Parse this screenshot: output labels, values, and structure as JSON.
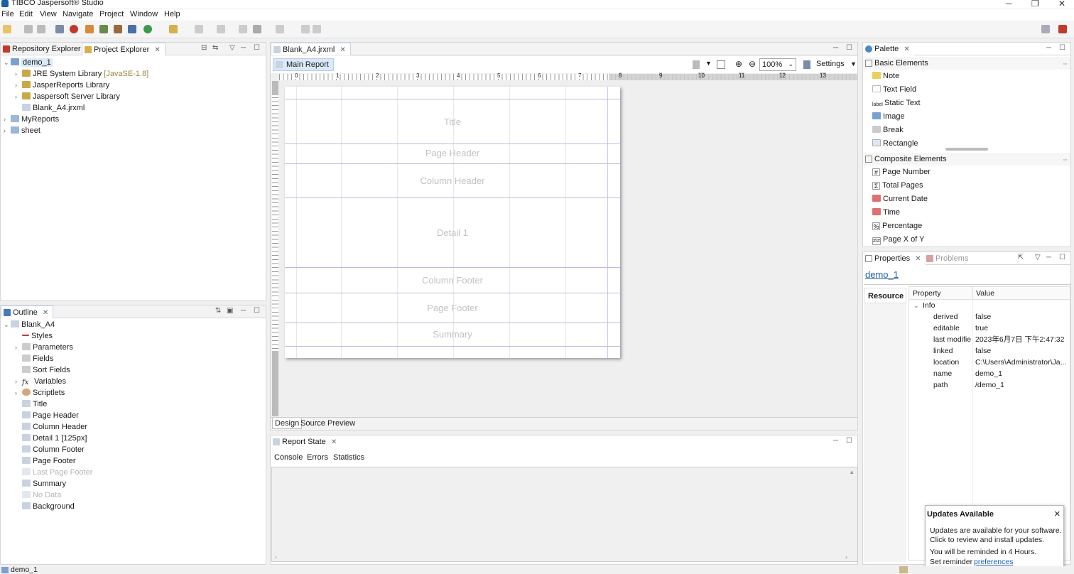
{
  "app": {
    "title": "TIBCO Jaspersoft® Studio"
  },
  "menu": [
    "File",
    "Edit",
    "View",
    "Navigate",
    "Project",
    "Window",
    "Help"
  ],
  "project_panel": {
    "tabs": [
      {
        "label": "Repository Explorer"
      },
      {
        "label": "Project Explorer"
      }
    ],
    "tree": [
      {
        "label": "demo_1"
      },
      {
        "label": "JRE System Library"
      },
      {
        "label": "[JavaSE-1.8]"
      },
      {
        "label": "JasperReports Library"
      },
      {
        "label": "Jaspersoft Server Library"
      },
      {
        "label": "Blank_A4.jrxml"
      },
      {
        "label": "MyReports"
      },
      {
        "label": "sheet"
      }
    ]
  },
  "outline": {
    "tab": "Outline",
    "items": [
      "Blank_A4",
      "Styles",
      "Parameters",
      "Fields",
      "Sort Fields",
      "Variables",
      "Scriptlets",
      "Title",
      "Page Header",
      "Column Header",
      "Detail 1 [125px]",
      "Column Footer",
      "Page Footer",
      "Last Page Footer",
      "Summary",
      "No Data",
      "Background"
    ]
  },
  "editor": {
    "tab": "Blank_A4.jrxml",
    "subtab": "Main Report",
    "zoom": "100%",
    "settings": "Settings",
    "ruler_numbers": [
      "0",
      "1",
      "2",
      "3",
      "4",
      "5",
      "6",
      "7",
      "8",
      "9",
      "10",
      "11",
      "12",
      "13"
    ],
    "bands": [
      "Title",
      "Page Header",
      "Column Header",
      "Detail 1",
      "Column Footer",
      "Page Footer",
      "Summary"
    ],
    "bottom_tabs": [
      "Design",
      "Source",
      "Preview"
    ]
  },
  "report_state": {
    "tab": "Report State",
    "tabs": [
      "Console",
      "Errors",
      "Statistics"
    ]
  },
  "palette": {
    "tab": "Palette",
    "basic_header": "Basic Elements",
    "basic": [
      "Note",
      "Text Field",
      "Static Text",
      "Image",
      "Break",
      "Rectangle"
    ],
    "composite_header": "Composite Elements",
    "composite": [
      "Page Number",
      "Total Pages",
      "Current Date",
      "Time",
      "Percentage",
      "Page X of Y"
    ]
  },
  "properties": {
    "tab": "Properties",
    "problems_tab": "Problems",
    "title": "demo_1",
    "side_tab": "Resource",
    "col_property": "Property",
    "col_value": "Value",
    "group": "Info",
    "rows": [
      {
        "k": "derived",
        "v": "false"
      },
      {
        "k": "editable",
        "v": "true"
      },
      {
        "k": "last modifie",
        "v": "2023年6月7日 下午2:47:32"
      },
      {
        "k": "linked",
        "v": "false"
      },
      {
        "k": "location",
        "v": "C:\\Users\\Administrator\\Ja..."
      },
      {
        "k": "name",
        "v": "demo_1"
      },
      {
        "k": "path",
        "v": "/demo_1"
      }
    ]
  },
  "updates": {
    "title": "Updates Available",
    "line1": "Updates are available for your software.",
    "line2": "Click to review and install updates.",
    "line3": "You will be reminded in 4 Hours.",
    "line4": "Set reminder",
    "link": "preferences"
  },
  "status": {
    "text": "demo_1"
  },
  "colors": {
    "accent": "#1b5fa8",
    "band_line": "#b9bbe6"
  }
}
